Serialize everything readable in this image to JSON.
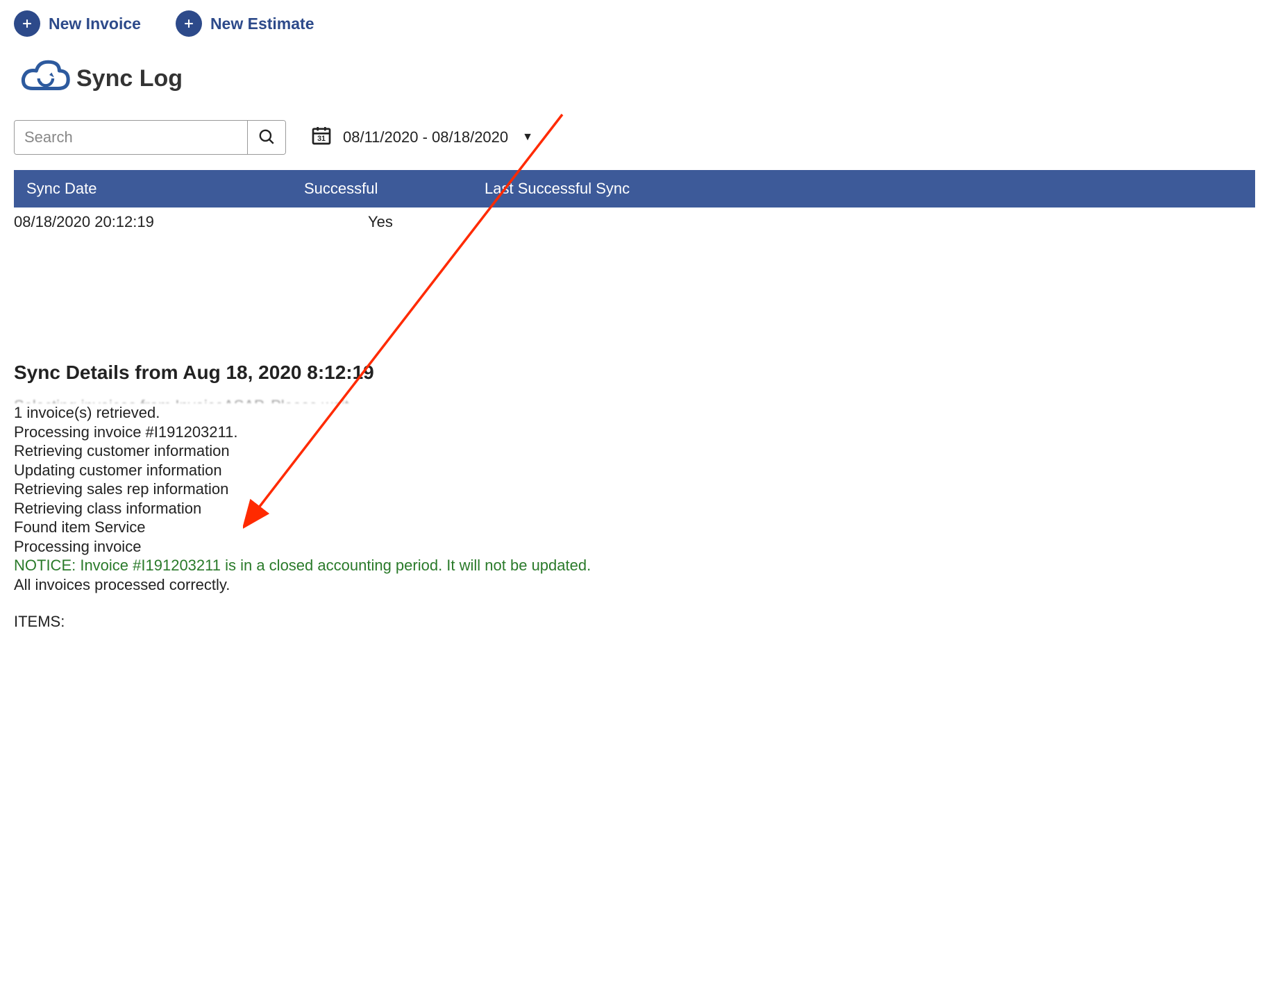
{
  "top_actions": {
    "new_invoice": "New Invoice",
    "new_estimate": "New Estimate"
  },
  "page": {
    "title": "Sync Log"
  },
  "search": {
    "placeholder": "Search"
  },
  "date_range": {
    "display": "08/11/2020 - 08/18/2020"
  },
  "table": {
    "headers": {
      "sync_date": "Sync Date",
      "successful": "Successful",
      "last_successful": "Last Successful Sync"
    },
    "rows": [
      {
        "sync_date": "08/18/2020 20:12:19",
        "successful": "Yes",
        "last_successful": ""
      }
    ]
  },
  "details": {
    "title": "Sync Details from Aug 18, 2020 8:12:19",
    "lines": {
      "cut": "Selecting invoices from InvoiceASAP. Please wait.",
      "l1": "1 invoice(s) retrieved.",
      "l2": "Processing invoice #I191203211.",
      "l3": "Retrieving customer information",
      "l4": "Updating customer information",
      "l5": "Retrieving sales rep information",
      "l6": "Retrieving class information",
      "l7": "Found item Service",
      "l8": "Processing invoice",
      "notice": "NOTICE: Invoice #I191203211 is in a closed accounting period. It will not be updated.",
      "l9": "All invoices processed correctly.",
      "items": "ITEMS:"
    }
  }
}
